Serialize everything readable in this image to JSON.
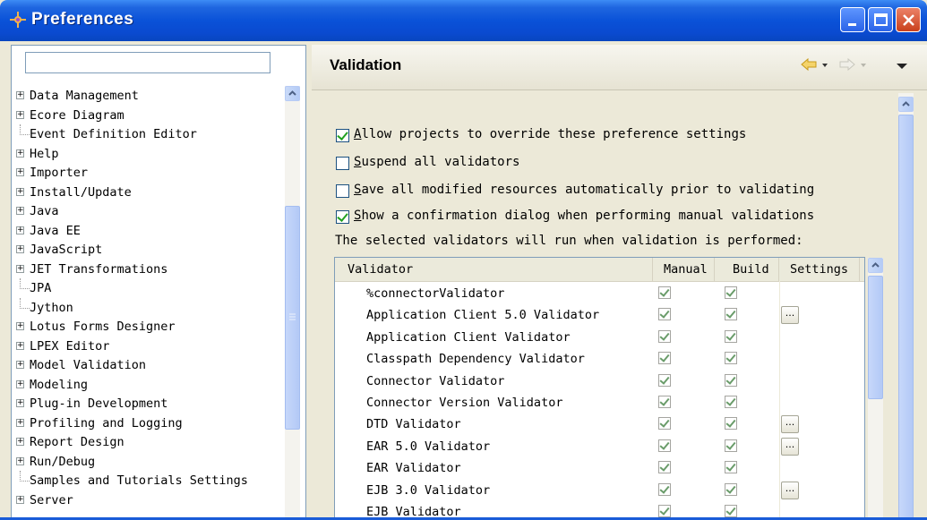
{
  "window": {
    "title": "Preferences",
    "controls": [
      "minimize",
      "maximize",
      "close"
    ]
  },
  "sidebar": {
    "filter": {
      "value": "",
      "placeholder": ""
    },
    "items": [
      {
        "label": "Data Management",
        "expandable": true
      },
      {
        "label": "Ecore Diagram",
        "expandable": true
      },
      {
        "label": "Event Definition Editor",
        "expandable": false
      },
      {
        "label": "Help",
        "expandable": true
      },
      {
        "label": "Importer",
        "expandable": true
      },
      {
        "label": "Install/Update",
        "expandable": true
      },
      {
        "label": "Java",
        "expandable": true
      },
      {
        "label": "Java EE",
        "expandable": true
      },
      {
        "label": "JavaScript",
        "expandable": true
      },
      {
        "label": "JET Transformations",
        "expandable": true
      },
      {
        "label": "JPA",
        "expandable": false
      },
      {
        "label": "Jython",
        "expandable": false
      },
      {
        "label": "Lotus Forms Designer",
        "expandable": true
      },
      {
        "label": "LPEX Editor",
        "expandable": true
      },
      {
        "label": "Model Validation",
        "expandable": true
      },
      {
        "label": "Modeling",
        "expandable": true
      },
      {
        "label": "Plug-in Development",
        "expandable": true
      },
      {
        "label": "Profiling and Logging",
        "expandable": true
      },
      {
        "label": "Report Design",
        "expandable": true
      },
      {
        "label": "Run/Debug",
        "expandable": true
      },
      {
        "label": "Samples and Tutorials Settings",
        "expandable": false
      },
      {
        "label": "Server",
        "expandable": true
      }
    ]
  },
  "page": {
    "title": "Validation",
    "nav": {
      "back_icon": "back-arrow-icon",
      "forward_icon": "forward-arrow-icon",
      "menu_icon": "view-menu-icon"
    }
  },
  "options": [
    {
      "label": "Allow projects to override these preference settings",
      "checked": true
    },
    {
      "label": "Suspend all validators",
      "checked": false
    },
    {
      "label": "Save all modified resources automatically prior to validating",
      "checked": false
    },
    {
      "label": "Show a confirmation dialog when performing manual validations",
      "checked": true
    }
  ],
  "table_caption": "The selected validators will run when validation is performed:",
  "table": {
    "columns": [
      "Validator",
      "Manual",
      "Build",
      "Settings"
    ],
    "rows": [
      {
        "name": "%connectorValidator",
        "manual": true,
        "build": true,
        "settings": false
      },
      {
        "name": "Application Client 5.0 Validator",
        "manual": true,
        "build": true,
        "settings": true
      },
      {
        "name": "Application Client Validator",
        "manual": true,
        "build": true,
        "settings": false
      },
      {
        "name": "Classpath Dependency Validator",
        "manual": true,
        "build": true,
        "settings": false
      },
      {
        "name": "Connector Validator",
        "manual": true,
        "build": true,
        "settings": false
      },
      {
        "name": "Connector Version Validator",
        "manual": true,
        "build": true,
        "settings": false
      },
      {
        "name": "DTD Validator",
        "manual": true,
        "build": true,
        "settings": true
      },
      {
        "name": "EAR 5.0 Validator",
        "manual": true,
        "build": true,
        "settings": true
      },
      {
        "name": "EAR Validator",
        "manual": true,
        "build": true,
        "settings": false
      },
      {
        "name": "EJB 3.0 Validator",
        "manual": true,
        "build": true,
        "settings": true
      },
      {
        "name": "EJB Validator",
        "manual": true,
        "build": true,
        "settings": false
      }
    ],
    "settings_button_label": "..."
  },
  "colors": {
    "titlebar": "#0a52d8",
    "dialog_bg": "#ece9d8",
    "checkbox_check": "#21a121",
    "border": "#7f9db9"
  }
}
